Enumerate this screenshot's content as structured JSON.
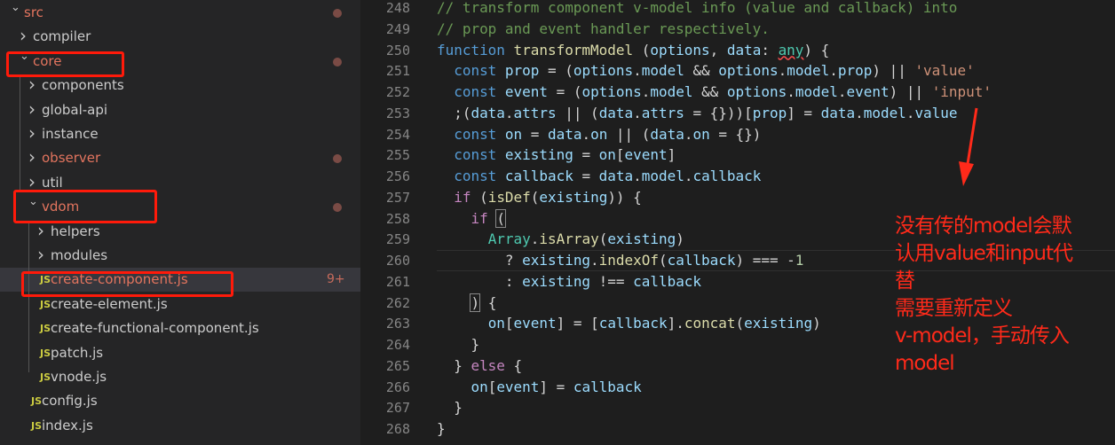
{
  "explorer": {
    "items": [
      {
        "label": "src",
        "depth": 0,
        "type": "folder",
        "open": true,
        "modified": true
      },
      {
        "label": "compiler",
        "depth": 1,
        "type": "folder",
        "open": false
      },
      {
        "label": "core",
        "depth": 1,
        "type": "folder",
        "open": true,
        "modified": true
      },
      {
        "label": "components",
        "depth": 2,
        "type": "folder",
        "open": false
      },
      {
        "label": "global-api",
        "depth": 2,
        "type": "folder",
        "open": false
      },
      {
        "label": "instance",
        "depth": 2,
        "type": "folder",
        "open": false
      },
      {
        "label": "observer",
        "depth": 2,
        "type": "folder",
        "open": false,
        "modified": true
      },
      {
        "label": "util",
        "depth": 2,
        "type": "folder",
        "open": false
      },
      {
        "label": "vdom",
        "depth": 2,
        "type": "folder",
        "open": true,
        "modified": true
      },
      {
        "label": "helpers",
        "depth": 3,
        "type": "folder",
        "open": false
      },
      {
        "label": "modules",
        "depth": 3,
        "type": "folder",
        "open": false
      },
      {
        "label": "create-component.js",
        "depth": 3,
        "type": "file",
        "modified": true,
        "selected": true,
        "badge": "9+"
      },
      {
        "label": "create-element.js",
        "depth": 3,
        "type": "file"
      },
      {
        "label": "create-functional-component.js",
        "depth": 3,
        "type": "file"
      },
      {
        "label": "patch.js",
        "depth": 3,
        "type": "file"
      },
      {
        "label": "vnode.js",
        "depth": 3,
        "type": "file"
      },
      {
        "label": "config.js",
        "depth": 2,
        "type": "file"
      },
      {
        "label": "index.js",
        "depth": 2,
        "type": "file"
      }
    ],
    "file_icon_text": "JS"
  },
  "editor": {
    "lines": [
      {
        "n": "248",
        "t": [
          [
            "c",
            "// transform component v-model info (value and callback) into"
          ]
        ]
      },
      {
        "n": "249",
        "t": [
          [
            "c",
            "// prop and event handler respectively."
          ]
        ]
      },
      {
        "n": "250",
        "t": [
          [
            "k",
            "function "
          ],
          [
            "f",
            "transformModel"
          ],
          [
            "p",
            " ("
          ],
          [
            "v",
            "options"
          ],
          [
            "p",
            ", "
          ],
          [
            "v",
            "data"
          ],
          [
            "p",
            ": "
          ],
          [
            "t squig",
            "any"
          ],
          [
            "p",
            ") {"
          ]
        ]
      },
      {
        "n": "251",
        "t": [
          [
            "p",
            "  "
          ],
          [
            "k",
            "const "
          ],
          [
            "v",
            "prop"
          ],
          [
            "p",
            " = ("
          ],
          [
            "v",
            "options"
          ],
          [
            "p",
            "."
          ],
          [
            "v",
            "model"
          ],
          [
            "p",
            " && "
          ],
          [
            "v",
            "options"
          ],
          [
            "p",
            "."
          ],
          [
            "v",
            "model"
          ],
          [
            "p",
            "."
          ],
          [
            "v",
            "prop"
          ],
          [
            "p",
            ") || "
          ],
          [
            "s",
            "'value'"
          ]
        ]
      },
      {
        "n": "252",
        "t": [
          [
            "p",
            "  "
          ],
          [
            "k",
            "const "
          ],
          [
            "v",
            "event"
          ],
          [
            "p",
            " = ("
          ],
          [
            "v",
            "options"
          ],
          [
            "p",
            "."
          ],
          [
            "v",
            "model"
          ],
          [
            "p",
            " && "
          ],
          [
            "v",
            "options"
          ],
          [
            "p",
            "."
          ],
          [
            "v",
            "model"
          ],
          [
            "p",
            "."
          ],
          [
            "v",
            "event"
          ],
          [
            "p",
            ") || "
          ],
          [
            "s",
            "'input'"
          ]
        ]
      },
      {
        "n": "253",
        "t": [
          [
            "p",
            "  ;("
          ],
          [
            "v",
            "data"
          ],
          [
            "p",
            "."
          ],
          [
            "v",
            "attrs"
          ],
          [
            "p",
            " || ("
          ],
          [
            "v",
            "data"
          ],
          [
            "p",
            "."
          ],
          [
            "v",
            "attrs"
          ],
          [
            "p",
            " = {}))["
          ],
          [
            "v",
            "prop"
          ],
          [
            "p",
            "] = "
          ],
          [
            "v",
            "data"
          ],
          [
            "p",
            "."
          ],
          [
            "v",
            "model"
          ],
          [
            "p",
            "."
          ],
          [
            "v",
            "value"
          ]
        ]
      },
      {
        "n": "254",
        "t": [
          [
            "p",
            "  "
          ],
          [
            "k",
            "const "
          ],
          [
            "v",
            "on"
          ],
          [
            "p",
            " = "
          ],
          [
            "v",
            "data"
          ],
          [
            "p",
            "."
          ],
          [
            "v",
            "on"
          ],
          [
            "p",
            " || ("
          ],
          [
            "v",
            "data"
          ],
          [
            "p",
            "."
          ],
          [
            "v",
            "on"
          ],
          [
            "p",
            " = {})"
          ]
        ]
      },
      {
        "n": "255",
        "t": [
          [
            "p",
            "  "
          ],
          [
            "k",
            "const "
          ],
          [
            "v",
            "existing"
          ],
          [
            "p",
            " = "
          ],
          [
            "v",
            "on"
          ],
          [
            "p",
            "["
          ],
          [
            "v",
            "event"
          ],
          [
            "p",
            "]"
          ]
        ]
      },
      {
        "n": "256",
        "t": [
          [
            "p",
            "  "
          ],
          [
            "k",
            "const "
          ],
          [
            "v",
            "callback"
          ],
          [
            "p",
            " = "
          ],
          [
            "v",
            "data"
          ],
          [
            "p",
            "."
          ],
          [
            "v",
            "model"
          ],
          [
            "p",
            "."
          ],
          [
            "v",
            "callback"
          ]
        ]
      },
      {
        "n": "257",
        "t": [
          [
            "p",
            "  "
          ],
          [
            "ctl",
            "if"
          ],
          [
            "p",
            " ("
          ],
          [
            "f",
            "isDef"
          ],
          [
            "p",
            "("
          ],
          [
            "v",
            "existing"
          ],
          [
            "p",
            ")) {"
          ]
        ]
      },
      {
        "n": "258",
        "t": [
          [
            "p",
            "    "
          ],
          [
            "ctl",
            "if"
          ],
          [
            "p",
            " "
          ],
          [
            "p bx",
            "("
          ]
        ]
      },
      {
        "n": "259",
        "t": [
          [
            "p",
            "      "
          ],
          [
            "t",
            "Array"
          ],
          [
            "p",
            "."
          ],
          [
            "f",
            "isArray"
          ],
          [
            "p",
            "("
          ],
          [
            "v",
            "existing"
          ],
          [
            "p",
            ")"
          ]
        ]
      },
      {
        "n": "260",
        "t": [
          [
            "p",
            "        ? "
          ],
          [
            "v",
            "existing"
          ],
          [
            "p",
            "."
          ],
          [
            "f",
            "indexOf"
          ],
          [
            "p",
            "("
          ],
          [
            "v",
            "callback"
          ],
          [
            "p",
            ") === -"
          ],
          [
            "n",
            "1"
          ]
        ]
      },
      {
        "n": "261",
        "t": [
          [
            "p",
            "        : "
          ],
          [
            "v",
            "existing"
          ],
          [
            "p",
            " !== "
          ],
          [
            "v",
            "callback"
          ]
        ]
      },
      {
        "n": "262",
        "t": [
          [
            "p",
            "    "
          ],
          [
            "p bx",
            ")"
          ],
          [
            "p",
            " {"
          ]
        ]
      },
      {
        "n": "263",
        "t": [
          [
            "p",
            "      "
          ],
          [
            "v",
            "on"
          ],
          [
            "p",
            "["
          ],
          [
            "v",
            "event"
          ],
          [
            "p",
            "] = ["
          ],
          [
            "v",
            "callback"
          ],
          [
            "p",
            "]."
          ],
          [
            "f",
            "concat"
          ],
          [
            "p",
            "("
          ],
          [
            "v",
            "existing"
          ],
          [
            "p",
            ")"
          ]
        ]
      },
      {
        "n": "264",
        "t": [
          [
            "p",
            "    }"
          ]
        ]
      },
      {
        "n": "265",
        "t": [
          [
            "p",
            "  } "
          ],
          [
            "ctl",
            "else"
          ],
          [
            "p",
            " {"
          ]
        ]
      },
      {
        "n": "266",
        "t": [
          [
            "p",
            "    "
          ],
          [
            "v",
            "on"
          ],
          [
            "p",
            "["
          ],
          [
            "v",
            "event"
          ],
          [
            "p",
            "] = "
          ],
          [
            "v",
            "callback"
          ]
        ]
      },
      {
        "n": "267",
        "t": [
          [
            "p",
            "  }"
          ]
        ]
      },
      {
        "n": "268",
        "t": [
          [
            "p",
            "}"
          ]
        ]
      }
    ]
  },
  "annotation": {
    "lines": [
      "没有传的model会默",
      "认用value和input代",
      "替",
      "需要重新定义",
      "v-model，手动传入",
      "model"
    ],
    "color": "#ff2a1a"
  }
}
